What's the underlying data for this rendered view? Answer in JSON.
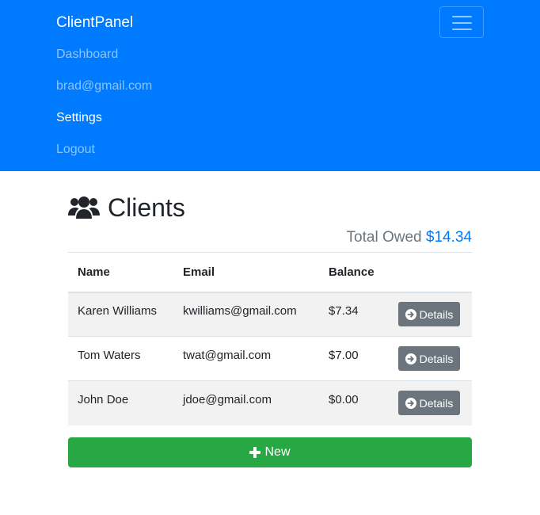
{
  "navbar": {
    "brand": "ClientPanel",
    "menu_toggle_icon": "hamburger-menu-icon",
    "links": [
      {
        "label": "Dashboard"
      },
      {
        "label": "brad@gmail.com"
      },
      {
        "label": "Settings"
      },
      {
        "label": "Logout"
      }
    ],
    "colors": {
      "background": "#007bff"
    }
  },
  "main": {
    "title": "Clients",
    "title_icon": "users-icon",
    "total_owed_label": "Total Owed",
    "total_owed_amount": "$14.34",
    "table": {
      "columns": [
        "Name",
        "Email",
        "Balance"
      ],
      "rows": [
        {
          "name": "Karen Williams",
          "email": "kwilliams@gmail.com",
          "balance": "$7.34",
          "action": "Details"
        },
        {
          "name": "Tom Waters",
          "email": "twat@gmail.com",
          "balance": "$7.00",
          "action": "Details"
        },
        {
          "name": "John Doe",
          "email": "jdoe@gmail.com",
          "balance": "$0.00",
          "action": "Details"
        }
      ]
    },
    "new_button_label": "New",
    "colors": {
      "accent": "#007bff",
      "success": "#28a745",
      "secondary": "#6c757d"
    }
  }
}
